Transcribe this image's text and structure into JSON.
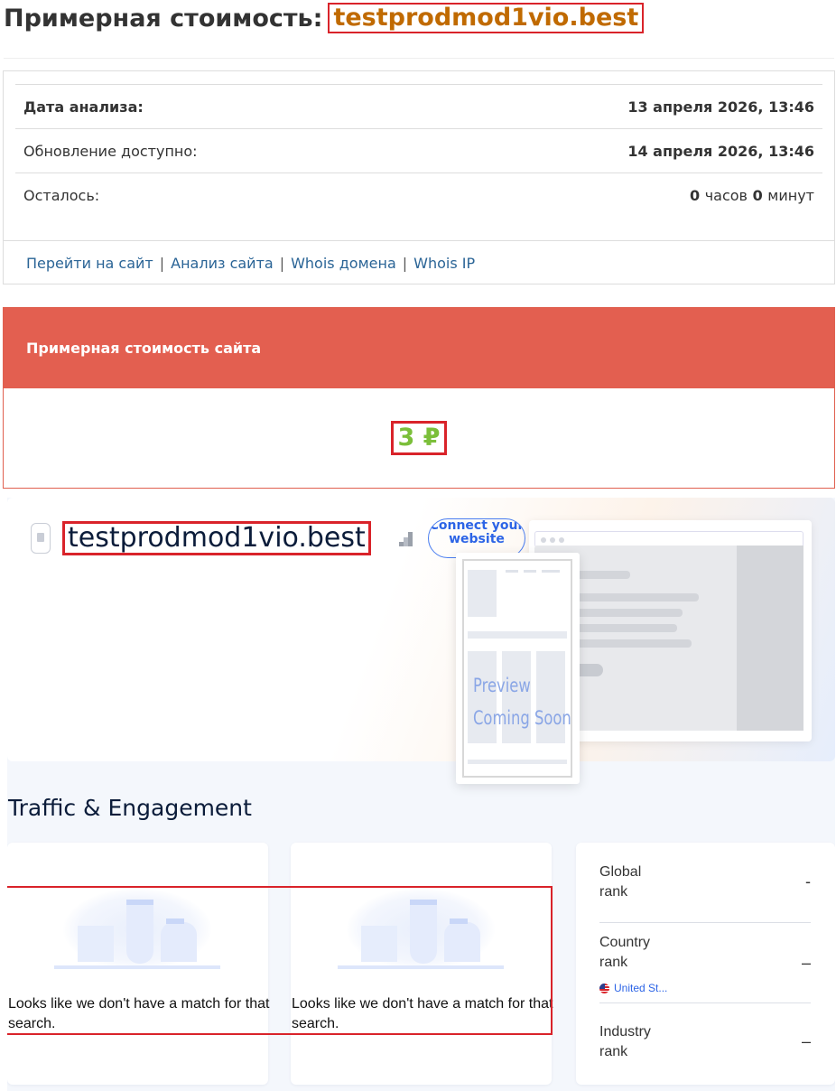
{
  "header": {
    "title_prefix": "Примерная стоимость:",
    "domain": "testprodmod1vio.best"
  },
  "info": {
    "rows": [
      {
        "label": "Дата анализа:",
        "value": "13 апреля 2026, 13:46"
      },
      {
        "label": "Обновление доступно:",
        "value": "14 апреля 2026, 13:46"
      },
      {
        "label": "Осталось:",
        "hours": "0",
        "hours_unit": "часов",
        "minutes": "0",
        "minutes_unit": "минут"
      }
    ],
    "links": [
      "Перейти на сайт",
      "Анализ сайта",
      "Whois домена",
      "Whois IP"
    ],
    "separator": "|"
  },
  "cost_panel": {
    "heading": "Примерная стоимость сайта",
    "value": "3 ₽"
  },
  "similarweb": {
    "domain": "testprodmod1vio.best",
    "connect_label": "Connect your website",
    "preview_line1": "Preview",
    "preview_line2": "Coming Soon",
    "section_title": "Traffic & Engagement",
    "no_match_text": "Looks like we don't have a match for that search.",
    "ranks": [
      {
        "label_line1": "Global",
        "label_line2": "rank",
        "value": "-"
      },
      {
        "label_line1": "Country",
        "label_line2": "rank",
        "value": "–",
        "country": "United St..."
      },
      {
        "label_line1": "Industry",
        "label_line2": "rank",
        "value": "–"
      }
    ]
  },
  "colors": {
    "accent_red": "#e35f50",
    "price_green": "#7bbf3a",
    "domain_orange": "#c06a00",
    "link_blue": "#2a6496",
    "highlight_border": "#d9232a"
  },
  "icons": [
    "file-icon",
    "bar-chart-icon",
    "us-flag-icon"
  ]
}
